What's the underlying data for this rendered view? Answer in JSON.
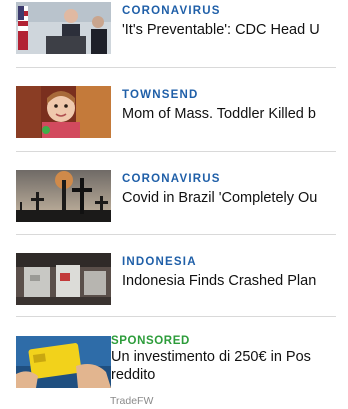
{
  "feed": {
    "items": [
      {
        "kicker": "CORONAVIRUS",
        "headline": "'It's Preventable': CDC Head U"
      },
      {
        "kicker": "TOWNSEND",
        "headline": "Mom of Mass. Toddler Killed b"
      },
      {
        "kicker": "CORONAVIRUS",
        "headline": "Covid in Brazil 'Completely Ou"
      },
      {
        "kicker": "INDONESIA",
        "headline": "Indonesia Finds Crashed Plan"
      }
    ],
    "sponsored": {
      "kicker": "SPONSORED",
      "headline": "Un investimento di 250€ in Pos reddito",
      "advertiser": "TradeFW"
    }
  },
  "colors": {
    "kicker": "#1f5fa8",
    "sponsored_kicker": "#2c9c3a",
    "divider": "#d9d9d9"
  }
}
